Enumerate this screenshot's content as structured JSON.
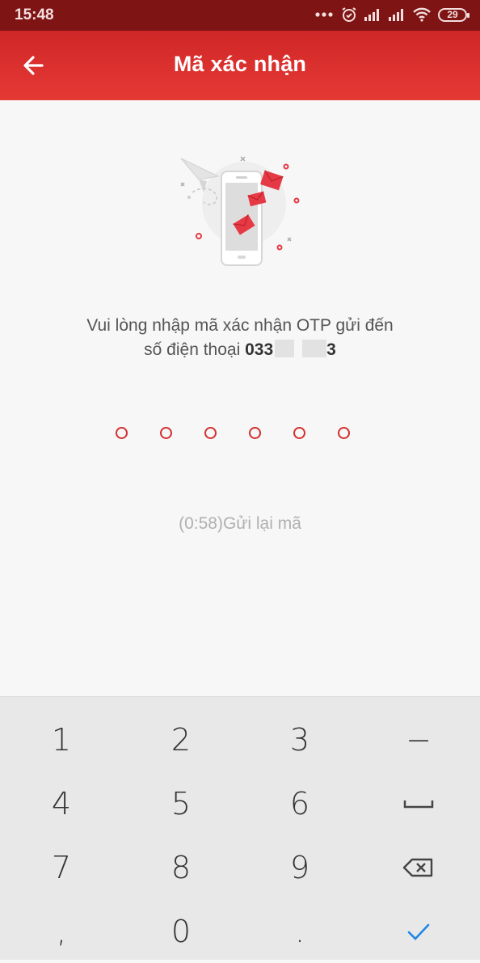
{
  "status_bar": {
    "time": "15:48",
    "battery": "29"
  },
  "header": {
    "title": "Mã xác nhận"
  },
  "content": {
    "instruction_line1": "Vui lòng nhập mã xác nhận OTP gửi đến",
    "instruction_line2_prefix": "số điện thoại",
    "phone_visible_start": "033",
    "phone_visible_end": "3",
    "otp_length": 6,
    "resend_text": "(0:58)Gửi lại mã"
  },
  "keyboard": {
    "k1": "1",
    "k2": "2",
    "k3": "3",
    "minus": "−",
    "k4": "4",
    "k5": "5",
    "k6": "6",
    "k7": "7",
    "k8": "8",
    "k9": "9",
    "comma": ",",
    "k0": "0",
    "dot": "."
  },
  "colors": {
    "primary_red": "#e53935",
    "status_bar": "#7e1414",
    "done_check": "#1e88e5"
  }
}
